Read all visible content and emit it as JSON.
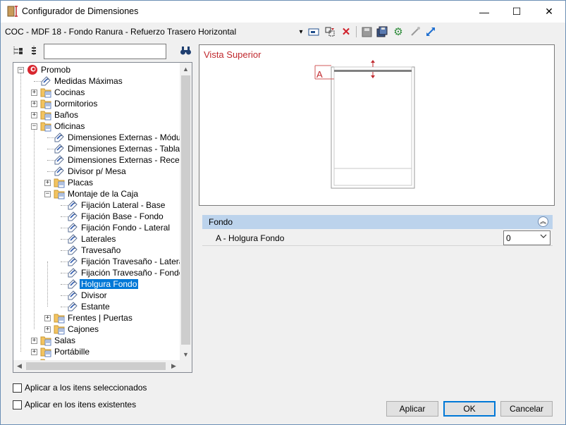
{
  "window": {
    "title": "Configurador de Dimensiones",
    "minimize_glyph": "—",
    "maximize_glyph": "☐",
    "close_glyph": "✕"
  },
  "toolbar": {
    "document_title": "COC - MDF 18 - Fondo Ranura - Refuerzo Trasero Horizontal",
    "dropdown_glyph": "▾",
    "icons": [
      "edit-dimension-icon",
      "insert-icon",
      "delete-icon",
      "save-icon",
      "save-all-icon",
      "settings-icon",
      "pin-icon",
      "resize-icon"
    ]
  },
  "tree_toolbar": {
    "search_value": "",
    "icons": [
      "expand-all-icon",
      "collapse-all-icon",
      "find-icon"
    ]
  },
  "tree": {
    "items": [
      {
        "label": "Promob",
        "level": 0,
        "type": "root",
        "expander": "−"
      },
      {
        "label": "Medidas Máximas",
        "level": 1,
        "type": "tag",
        "expander": ""
      },
      {
        "label": "Cocinas",
        "level": 1,
        "type": "folder",
        "expander": "+"
      },
      {
        "label": "Dormitorios",
        "level": 1,
        "type": "folder",
        "expander": "+"
      },
      {
        "label": "Baños",
        "level": 1,
        "type": "folder",
        "expander": "+"
      },
      {
        "label": "Oficinas",
        "level": 1,
        "type": "folder",
        "expander": "−"
      },
      {
        "label": "Dimensiones Externas - Módulos",
        "level": 2,
        "type": "tag",
        "expander": ""
      },
      {
        "label": "Dimensiones Externas - Tablas",
        "level": 2,
        "type": "tag",
        "expander": ""
      },
      {
        "label": "Dimensiones Externas - Recepcion",
        "level": 2,
        "type": "tag",
        "expander": ""
      },
      {
        "label": "Divisor p/ Mesa",
        "level": 2,
        "type": "tag",
        "expander": ""
      },
      {
        "label": "Placas",
        "level": 2,
        "type": "folder",
        "expander": "+"
      },
      {
        "label": "Montaje de la Caja",
        "level": 2,
        "type": "folder",
        "expander": "−"
      },
      {
        "label": "Fijación Lateral - Base",
        "level": 3,
        "type": "tag",
        "expander": ""
      },
      {
        "label": " Fijación Base - Fondo",
        "level": 3,
        "type": "tag",
        "expander": ""
      },
      {
        "label": "Fijación Fondo - Lateral",
        "level": 3,
        "type": "tag",
        "expander": ""
      },
      {
        "label": "Laterales",
        "level": 3,
        "type": "tag",
        "expander": ""
      },
      {
        "label": "Travesaño",
        "level": 3,
        "type": "tag",
        "expander": ""
      },
      {
        "label": "Fijación Travesaño - Lateral",
        "level": 3,
        "type": "tag",
        "expander": ""
      },
      {
        "label": "Fijación Travesaño - Fondo",
        "level": 3,
        "type": "tag",
        "expander": ""
      },
      {
        "label": "Holgura Fondo",
        "level": 3,
        "type": "tag",
        "expander": "",
        "selected": true
      },
      {
        "label": "Divisor",
        "level": 3,
        "type": "tag",
        "expander": ""
      },
      {
        "label": "Estante",
        "level": 3,
        "type": "tag",
        "expander": ""
      },
      {
        "label": "Frentes | Puertas",
        "level": 2,
        "type": "folder",
        "expander": "+"
      },
      {
        "label": "Cajones",
        "level": 2,
        "type": "folder",
        "expander": "+"
      },
      {
        "label": "Salas",
        "level": 1,
        "type": "folder",
        "expander": "+"
      },
      {
        "label": "Portábille",
        "level": 1,
        "type": "folder",
        "expander": "+"
      },
      {
        "label": "",
        "level": 1,
        "type": "folder",
        "expander": "+"
      }
    ]
  },
  "scroll_glyphs": {
    "up": "▲",
    "down": "▼",
    "left": "◀",
    "right": "▶"
  },
  "preview": {
    "title": "Vista Superior",
    "dimension_label": "A",
    "title_color": "#c0282d"
  },
  "properties": {
    "group_label": "Fondo",
    "collapse_glyph": "︽",
    "rows": [
      {
        "label": "A - Holgura Fondo",
        "value": "0"
      }
    ]
  },
  "options": {
    "apply_selected": "Aplicar a los itens seleccionados",
    "apply_existing": "Aplicar en los itens existentes"
  },
  "buttons": {
    "apply": "Aplicar",
    "ok": "OK",
    "cancel": "Cancelar"
  },
  "colors": {
    "selection": "#0078d7",
    "group_header": "#bcd3ec"
  }
}
